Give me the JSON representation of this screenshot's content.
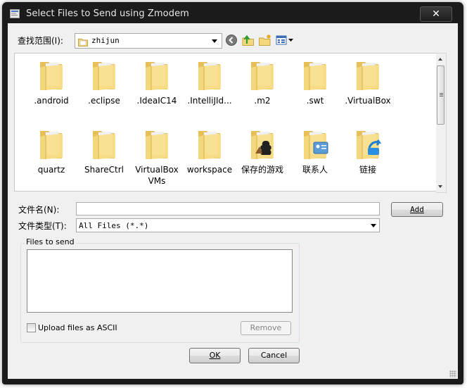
{
  "window": {
    "title": "Select Files to Send using Zmodem"
  },
  "lookin": {
    "label": "查找范围(I):",
    "value": "zhijun"
  },
  "toolbar": {
    "icons": [
      "back-icon",
      "up-folder-icon",
      "new-folder-icon",
      "view-menu-icon"
    ]
  },
  "files": [
    {
      "name": ".android",
      "type": "folder"
    },
    {
      "name": ".eclipse",
      "type": "folder"
    },
    {
      "name": ".IdeaIC14",
      "type": "folder"
    },
    {
      "name": ".IntelliJId...",
      "type": "folder"
    },
    {
      "name": ".m2",
      "type": "folder"
    },
    {
      "name": ".swt",
      "type": "folder"
    },
    {
      "name": ".VirtualBox",
      "type": "folder"
    },
    {
      "name": "quartz",
      "type": "folder"
    },
    {
      "name": "ShareCtrl",
      "type": "folder"
    },
    {
      "name": "VirtualBox VMs",
      "type": "folder"
    },
    {
      "name": "workspace",
      "type": "folder"
    },
    {
      "name": "保存的游戏",
      "type": "saved-games"
    },
    {
      "name": "联系人",
      "type": "contacts"
    },
    {
      "name": "链接",
      "type": "links"
    }
  ],
  "filename": {
    "label": "文件名(N):",
    "value": "",
    "add_label": "Add"
  },
  "filetype": {
    "label": "文件类型(T):",
    "value": "All Files (*.*)"
  },
  "send_group": {
    "title": "Files to send",
    "items": [],
    "ascii_label": "Upload files as ASCII",
    "ascii_checked": false,
    "remove_label": "Remove"
  },
  "buttons": {
    "ok": "OK",
    "cancel": "Cancel"
  },
  "colors": {
    "folder": "#f2d77c",
    "titlebar": "#1b1b1b",
    "dialog_bg": "#f0f0f0"
  }
}
